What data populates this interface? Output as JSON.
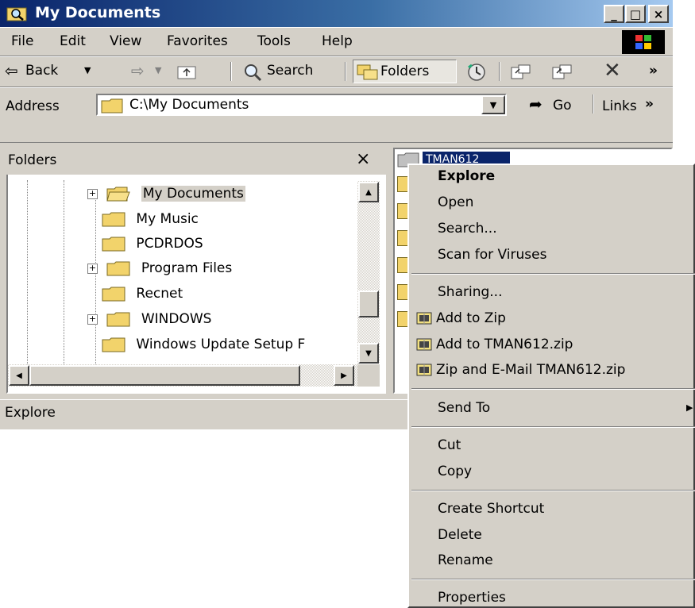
{
  "window": {
    "title": "My Documents",
    "controls": [
      "_",
      "□",
      "×"
    ]
  },
  "menubar": {
    "items": [
      "File",
      "Edit",
      "View",
      "Favorites",
      "Tools",
      "Help"
    ]
  },
  "toolbar": {
    "back": "Back",
    "search": "Search",
    "folders": "Folders",
    "overflow": "»"
  },
  "addressbar": {
    "label": "Address",
    "value": "C:\\My Documents",
    "go": "Go",
    "links": "Links",
    "links_overflow": "»"
  },
  "folders_pane": {
    "title": "Folders",
    "close": "×",
    "tree": [
      {
        "label": "My Documents",
        "expandable": true,
        "selected": true,
        "open": true
      },
      {
        "label": "My Music",
        "expandable": false
      },
      {
        "label": "PCDRDOS",
        "expandable": false
      },
      {
        "label": "Program Files",
        "expandable": true
      },
      {
        "label": "Recnet",
        "expandable": false
      },
      {
        "label": "WINDOWS",
        "expandable": true
      },
      {
        "label": "Windows Update Setup F",
        "expandable": false
      }
    ]
  },
  "file_pane": {
    "selected_item": "TMAN612"
  },
  "statusbar": {
    "text": "Explore"
  },
  "context_menu": {
    "items": [
      {
        "label": "Explore",
        "bold": true
      },
      {
        "label": "Open"
      },
      {
        "label": "Search..."
      },
      {
        "label": "Scan for Viruses"
      },
      {
        "sep": true
      },
      {
        "label": "Sharing..."
      },
      {
        "label": "Add to Zip",
        "icon": "winzip-icon"
      },
      {
        "label": "Add to TMAN612.zip",
        "icon": "winzip-icon"
      },
      {
        "label": "Zip and E-Mail TMAN612.zip",
        "icon": "winzip-icon"
      },
      {
        "sep": true
      },
      {
        "label": "Send To",
        "submenu": true
      },
      {
        "sep": true
      },
      {
        "label": "Cut"
      },
      {
        "label": "Copy"
      },
      {
        "sep": true
      },
      {
        "label": "Create Shortcut"
      },
      {
        "label": "Delete"
      },
      {
        "label": "Rename"
      },
      {
        "sep": true
      },
      {
        "label": "Properties"
      }
    ]
  },
  "colors": {
    "title_active": "#0a246a",
    "title_gradient_end": "#a6caf0",
    "face": "#d4d0c8",
    "selection": "#0a246a"
  }
}
